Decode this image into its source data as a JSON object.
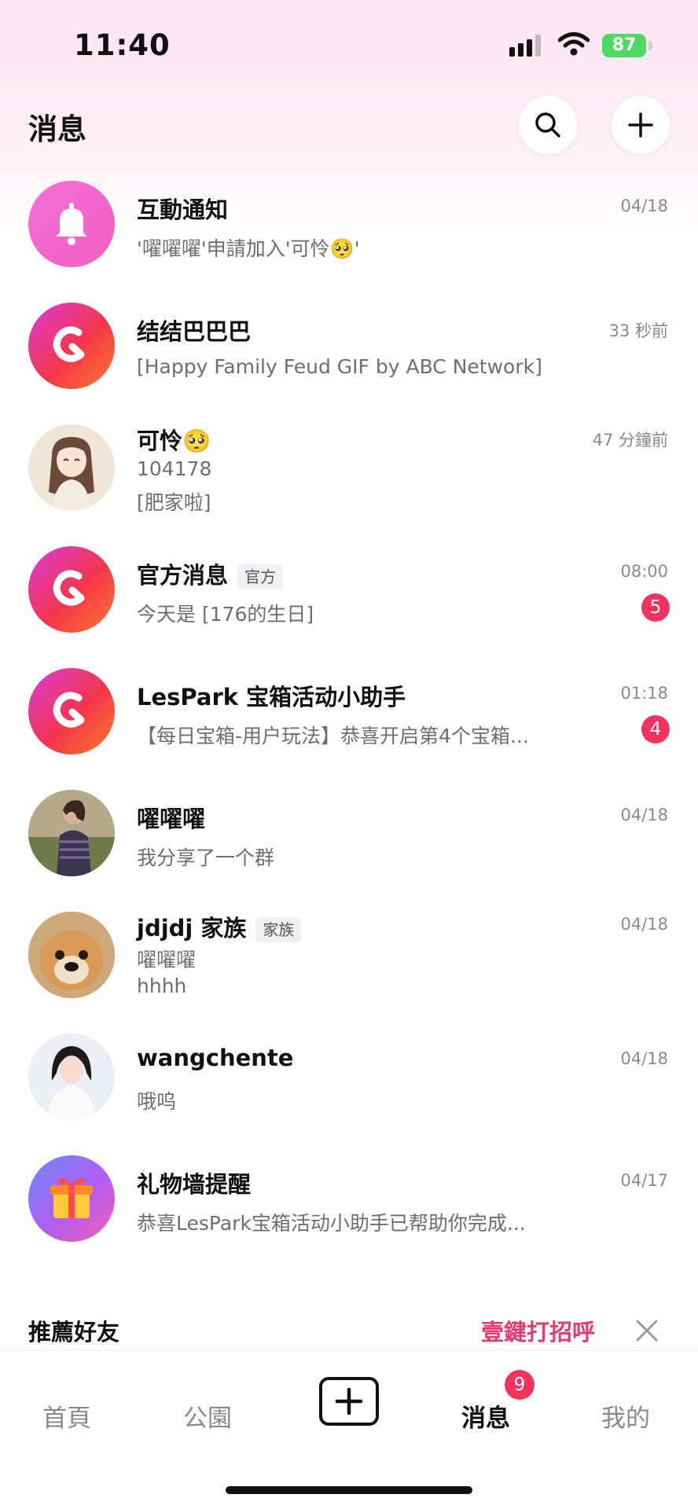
{
  "status": {
    "time": "11:40",
    "battery": "87"
  },
  "header": {
    "title": "消息"
  },
  "conversations": [
    {
      "name": "互動通知",
      "lines": [
        "'嚁嚁嚁'申請加入'可怜🥺'"
      ],
      "time": "04/18"
    },
    {
      "name": "结结巴巴巴",
      "lines": [
        "[Happy Family Feud GIF by ABC Network]"
      ],
      "time": "33 秒前"
    },
    {
      "name": "可怜🥺",
      "lines": [
        "104178",
        "[肥家啦]"
      ],
      "time": "47 分鐘前"
    },
    {
      "name": "官方消息",
      "tag": "官方",
      "lines": [
        "今天是 [176的生日]"
      ],
      "time": "08:00",
      "badge": "5"
    },
    {
      "name": "LesPark 宝箱活动小助手",
      "lines": [
        "【每日宝箱-用户玩法】恭喜开启第4个宝箱..."
      ],
      "time": "01:18",
      "badge": "4"
    },
    {
      "name": "嚁嚁嚁",
      "lines": [
        "我分享了一个群"
      ],
      "time": "04/18"
    },
    {
      "name": "jdjdj 家族",
      "tag": "家族",
      "lines": [
        "嚁嚁嚁",
        "hhhh"
      ],
      "time": "04/18"
    },
    {
      "name": "wangchente",
      "lines": [
        "哦呜"
      ],
      "time": "04/18"
    },
    {
      "name": "礼物墙提醒",
      "lines": [
        "恭喜LesPark宝箱活动小助手已帮助你完成..."
      ],
      "time": "04/17"
    }
  ],
  "recommend": {
    "title": "推薦好友",
    "action": "壹鍵打招呼"
  },
  "tabs": [
    {
      "label": "首頁"
    },
    {
      "label": "公園"
    },
    {
      "label": "消息",
      "badge": "9"
    },
    {
      "label": "我的"
    }
  ],
  "colors": {
    "accent": "#e93a6f",
    "badge": "#f2335d",
    "battery": "#4cd964"
  }
}
